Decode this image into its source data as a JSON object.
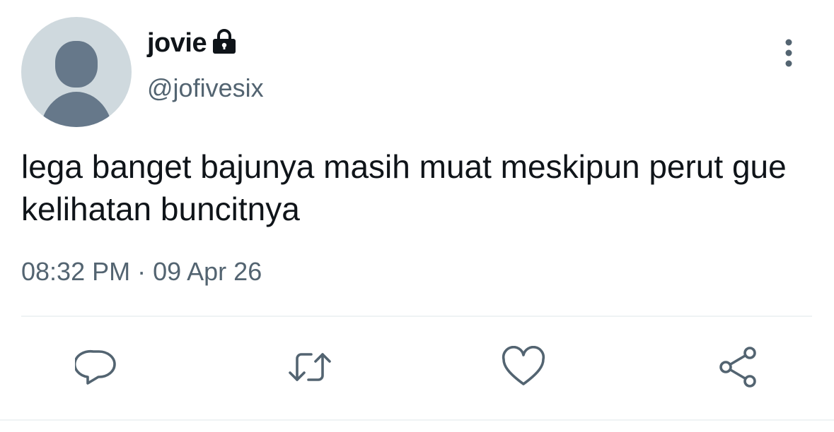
{
  "author": {
    "display_name": "jovie",
    "handle": "@jofivesix",
    "protected": true,
    "avatar": "default-avatar-icon"
  },
  "tweet": {
    "text": "lega banget bajunya masih muat meskipun perut gue kelihatan buncitnya",
    "time": "08:32 PM",
    "separator": "·",
    "date": "09 Apr 26"
  },
  "actions": [
    {
      "icon": "reply-icon"
    },
    {
      "icon": "retweet-icon"
    },
    {
      "icon": "like-icon"
    },
    {
      "icon": "share-icon"
    }
  ],
  "colors": {
    "text_primary": "#0f1419",
    "text_secondary": "#536471",
    "avatar_bg": "#cfd9de",
    "avatar_fg": "#66788a",
    "divider": "#eff3f4"
  }
}
